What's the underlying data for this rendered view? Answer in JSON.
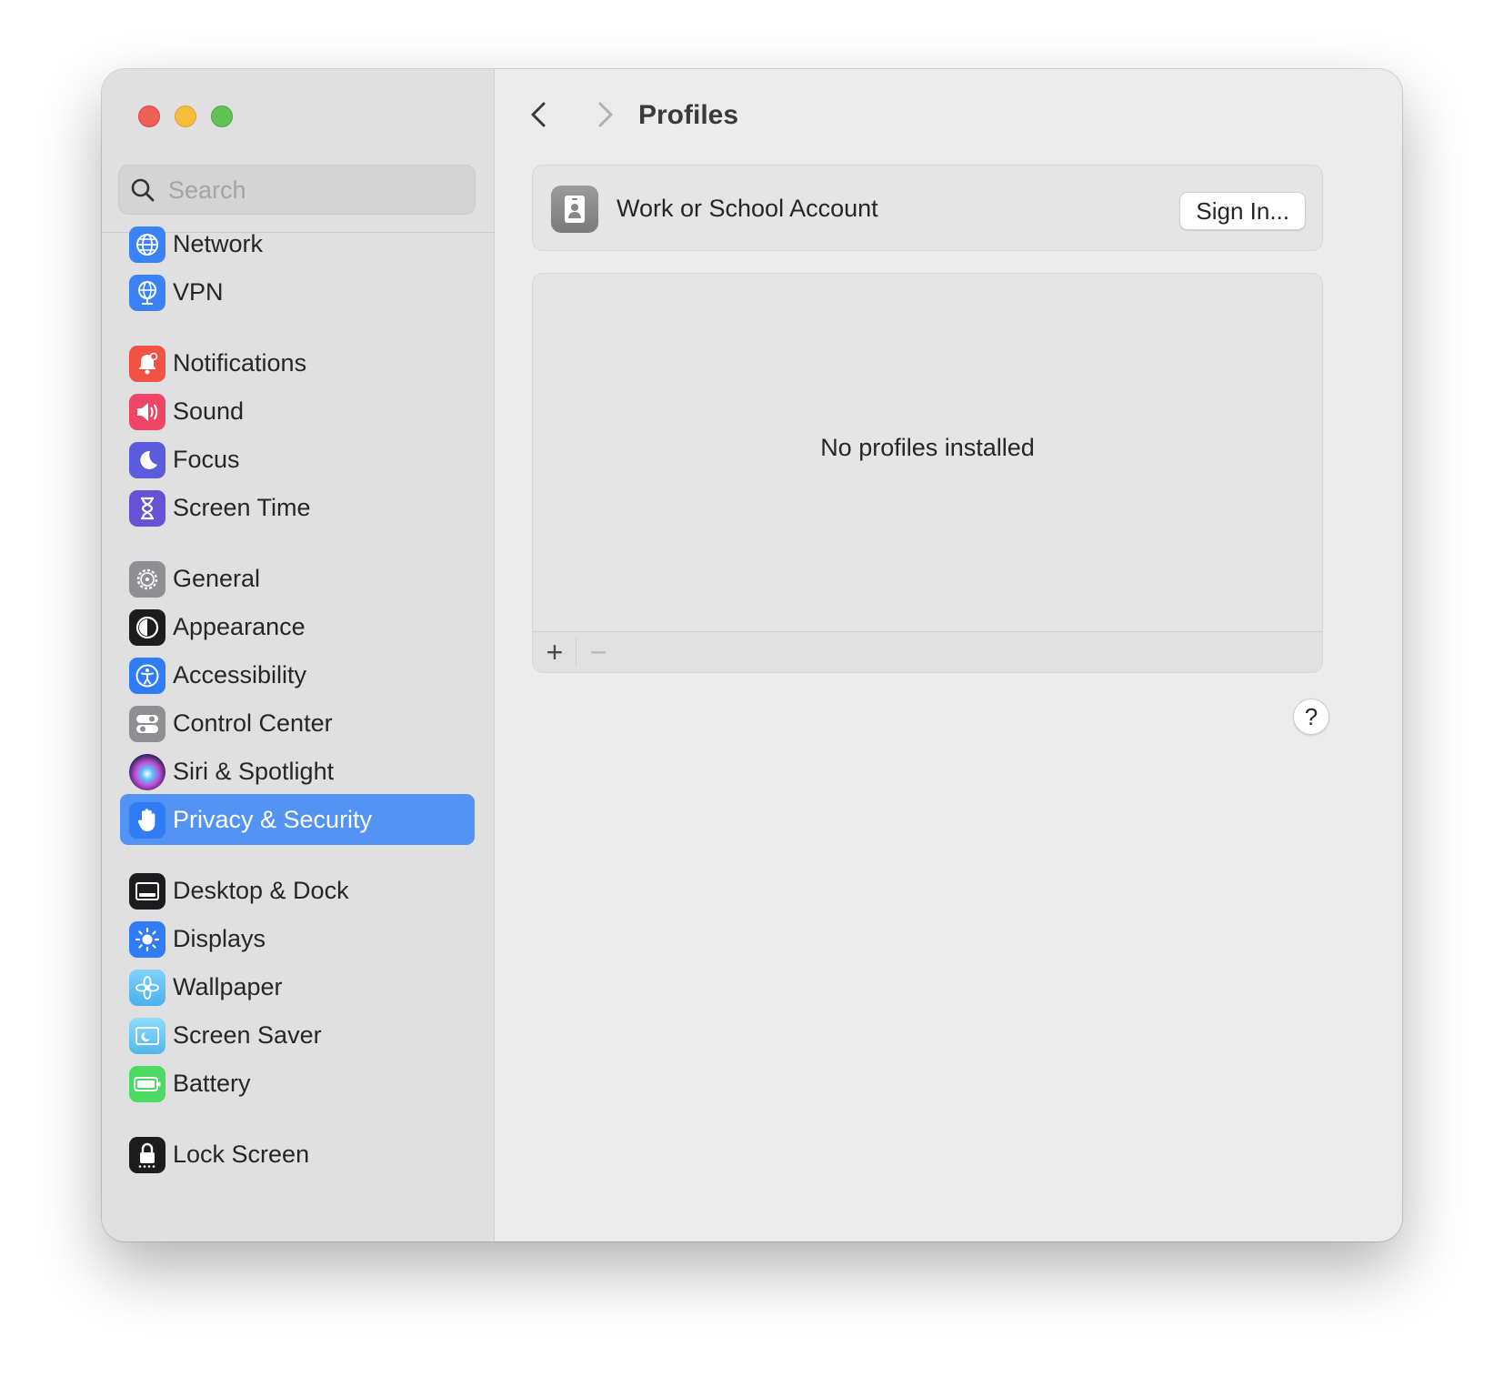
{
  "window": {
    "traffic_lights": [
      "close",
      "minimize",
      "zoom"
    ]
  },
  "sidebar": {
    "search": {
      "placeholder": "Search",
      "value": ""
    },
    "items": [
      {
        "label": "Network",
        "icon": "globe-icon",
        "color": "#3b82f6"
      },
      {
        "label": "VPN",
        "icon": "vpn-globe-icon",
        "color": "#3b82f6"
      },
      {
        "label": "Notifications",
        "icon": "bell-icon",
        "color": "#f05244"
      },
      {
        "label": "Sound",
        "icon": "speaker-icon",
        "color": "#ef4666"
      },
      {
        "label": "Focus",
        "icon": "moon-icon",
        "color": "#5b5bdc"
      },
      {
        "label": "Screen Time",
        "icon": "hourglass-icon",
        "color": "#6652d4"
      },
      {
        "label": "General",
        "icon": "gear-icon",
        "color": "#8e8e93"
      },
      {
        "label": "Appearance",
        "icon": "appearance-icon",
        "color": "#1c1c1e"
      },
      {
        "label": "Accessibility",
        "icon": "accessibility-icon",
        "color": "#2f7cf6"
      },
      {
        "label": "Control Center",
        "icon": "toggles-icon",
        "color": "#8e8e93"
      },
      {
        "label": "Siri & Spotlight",
        "icon": "siri-icon",
        "color": "#2b2b6b"
      },
      {
        "label": "Privacy & Security",
        "icon": "hand-icon",
        "color": "#2f7cf6",
        "selected": true
      },
      {
        "label": "Desktop & Dock",
        "icon": "dock-icon",
        "color": "#1c1c1e"
      },
      {
        "label": "Displays",
        "icon": "sun-icon",
        "color": "#2f7cf6"
      },
      {
        "label": "Wallpaper",
        "icon": "flower-icon",
        "color": "#5ac8fa"
      },
      {
        "label": "Screen Saver",
        "icon": "screensaver-icon",
        "color": "#64c4f0"
      },
      {
        "label": "Battery",
        "icon": "battery-icon",
        "color": "#4cd964"
      },
      {
        "label": "Lock Screen",
        "icon": "lock-icon",
        "color": "#1c1c1e"
      }
    ]
  },
  "main": {
    "title": "Profiles",
    "account": {
      "label": "Work or School Account",
      "button": "Sign In..."
    },
    "profiles": {
      "empty_text": "No profiles installed",
      "add": "+",
      "remove": "−"
    },
    "help": "?"
  },
  "colors": {
    "accent": "#5393f4",
    "sidebar_bg": "#e0e0e0",
    "main_bg": "#ececec"
  }
}
